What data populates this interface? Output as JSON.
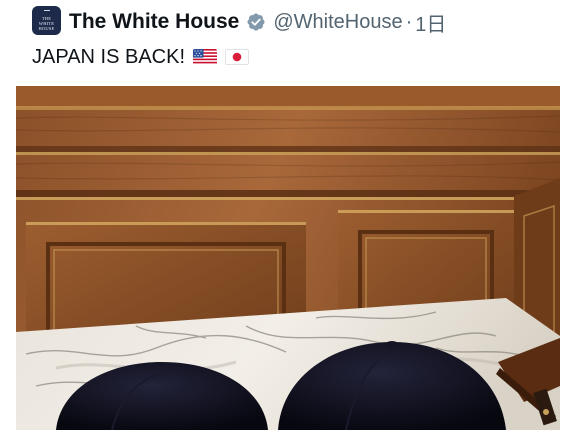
{
  "tweet": {
    "author": {
      "display_name": "The White House",
      "handle": "@WhiteHouse",
      "separator": "·",
      "timestamp": "1日",
      "verified": true,
      "avatar_text": [
        "THE",
        "WHITE",
        "HOUSE"
      ]
    },
    "text": "JAPAN IS BACK!",
    "flags": [
      "us-flag-emoji",
      "japan-flag-emoji"
    ],
    "media": {
      "type": "photo",
      "subject": "two navy caps on a marble table before wood paneling"
    }
  },
  "icons": {
    "verified": "verified-badge-icon"
  },
  "colors": {
    "text_primary": "#0f1419",
    "text_secondary": "#536471",
    "verified_badge": "#829aab",
    "background": "#ffffff"
  }
}
